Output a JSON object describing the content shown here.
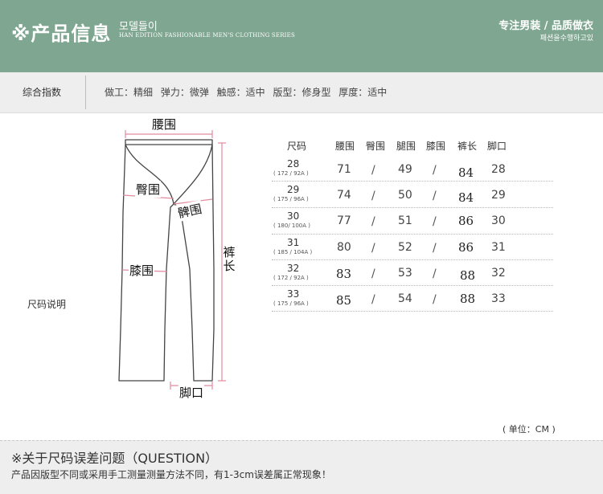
{
  "header": {
    "title": "※产品信息",
    "subtitle_kr": "모델들이",
    "subtitle_en": "HAN EDITION FASHIONABLE MEN'S CLOTHING SERIES",
    "slogan": "专注男装 / 品质做衣",
    "slogan_kr": "패션을수행하고있",
    "bg_color": "#7fa690"
  },
  "index": {
    "label": "综合指数",
    "attributes": "做工：精细   弹力：微弹   触感：适中   版型：修身型   厚度：适中"
  },
  "size_section_label": "尺码说明",
  "diagram": {
    "waist": "腰围",
    "hip": "臀围",
    "thigh": "髀围",
    "knee": "膝围",
    "length": "裤长",
    "hem": "脚口"
  },
  "table": {
    "headers": [
      "尺码",
      "腰围",
      "臀围",
      "腿围",
      "膝围",
      "裤长",
      "脚口"
    ],
    "separator": "/",
    "rows": [
      {
        "size": "28",
        "spec": "( 172 / 92A )",
        "waist": "71",
        "thigh": "49",
        "length": "84",
        "hem": "28"
      },
      {
        "size": "29",
        "spec": "( 175 / 96A )",
        "waist": "74",
        "thigh": "50",
        "length": "84",
        "hem": "29"
      },
      {
        "size": "30",
        "spec": "( 180/ 100A )",
        "waist": "77",
        "thigh": "51",
        "length": "86",
        "hem": "30"
      },
      {
        "size": "31",
        "spec": "( 185 / 104A )",
        "waist": "80",
        "thigh": "52",
        "length": "86",
        "hem": "31"
      },
      {
        "size": "32",
        "spec": "( 172 / 92A )",
        "waist": "83",
        "thigh": "53",
        "length": "88",
        "hem": "32"
      },
      {
        "size": "33",
        "spec": "( 175 / 96A )",
        "waist": "85",
        "thigh": "54",
        "length": "88",
        "hem": "33"
      }
    ]
  },
  "unit": "( 单位：CM )",
  "footer": {
    "title": "※关于尺码误差问题（QUESTION）",
    "note": "产品因版型不同或采用手工测量测量方法不同，有1-3cm误差属正常现象！"
  }
}
